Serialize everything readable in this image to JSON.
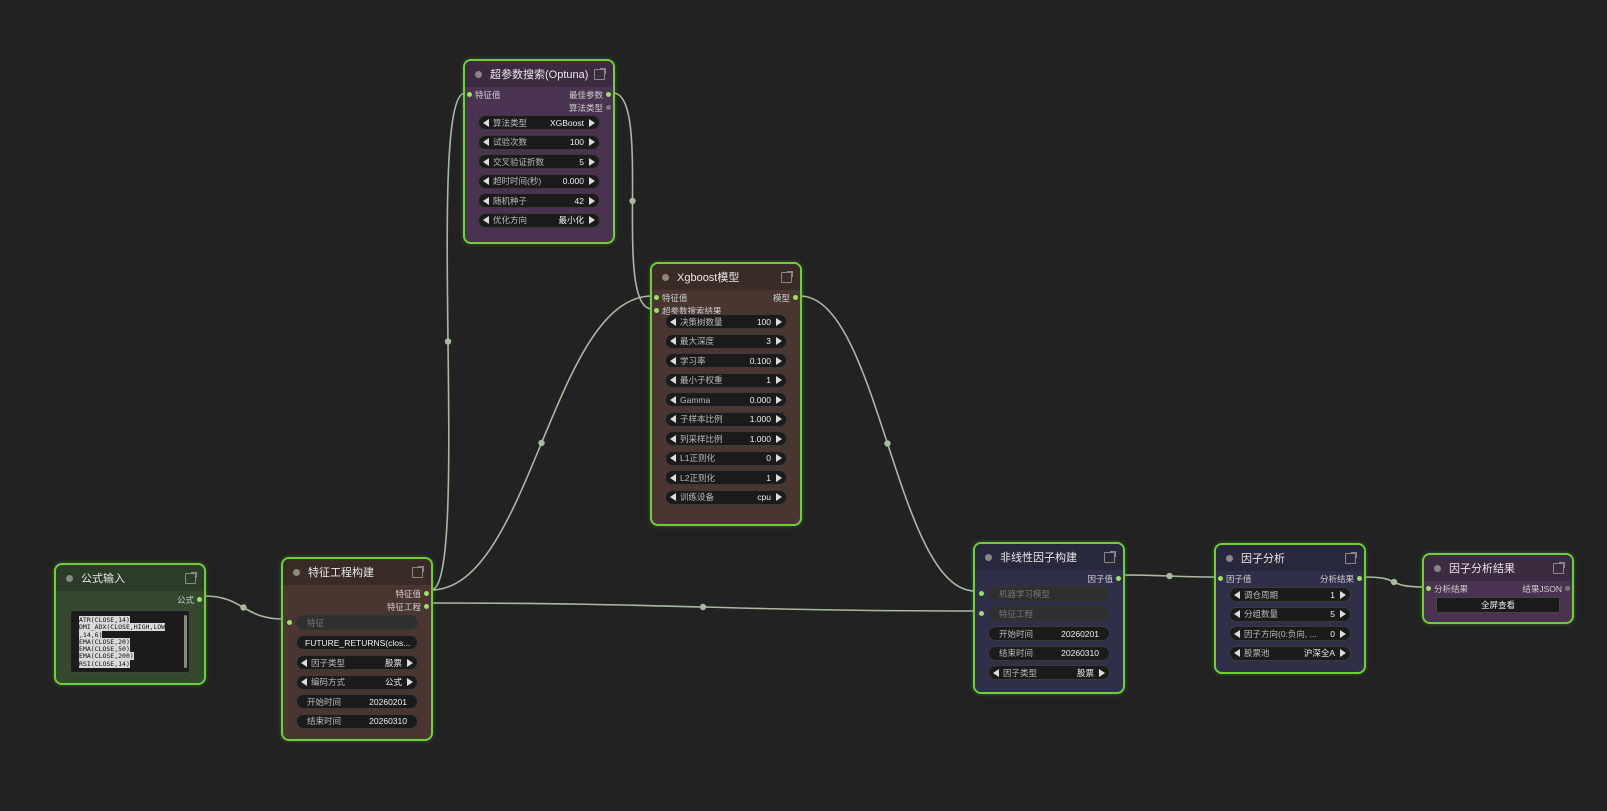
{
  "nodes": {
    "formula": {
      "title": "公式输入",
      "output": "公式",
      "lines": [
        "ATR(CLOSE,14)",
        "DMI_ADX(CLOSE,HIGH,LOW",
        ",14,6)",
        "EMA(CLOSE,20)",
        "EMA(CLOSE,50)",
        "EMA(CLOSE,200)",
        "RSI(CLOSE,14)"
      ],
      "colors": {
        "body": "#33482d",
        "head": "#2c3c28"
      }
    },
    "feature": {
      "title": "特征工程构建",
      "input": "特征",
      "outputs": [
        "特征值",
        "特征工程"
      ],
      "widget_input_label": "特征",
      "formula_value": "FUTURE_RETURNS(clos...",
      "widgets": [
        {
          "label": "因子类型",
          "value": "股票"
        },
        {
          "label": "编码方式",
          "value": "公式"
        },
        {
          "label": "开始时间",
          "value": "20260201"
        },
        {
          "label": "结束时间",
          "value": "20260310"
        }
      ],
      "colors": {
        "body": "#4a3630",
        "head": "#3b2b27"
      }
    },
    "optuna": {
      "title": "超参数搜索(Optuna)",
      "input": "特征值",
      "outputs": [
        "最佳参数",
        "算法类型"
      ],
      "widgets": [
        {
          "label": "算法类型",
          "value": "XGBoost"
        },
        {
          "label": "试验次数",
          "value": "100"
        },
        {
          "label": "交叉验证折数",
          "value": "5"
        },
        {
          "label": "超时时间(秒)",
          "value": "0.000"
        },
        {
          "label": "随机种子",
          "value": "42"
        },
        {
          "label": "优化方向",
          "value": "最小化"
        }
      ],
      "colors": {
        "body": "#4a3350",
        "head": "#3c2a40"
      }
    },
    "xgb": {
      "title": "Xgboost模型",
      "inputs": [
        "特征值",
        "超参数搜索结果"
      ],
      "output": "模型",
      "widgets": [
        {
          "label": "决策树数量",
          "value": "100"
        },
        {
          "label": "最大深度",
          "value": "3"
        },
        {
          "label": "学习率",
          "value": "0.100"
        },
        {
          "label": "最小子权重",
          "value": "1"
        },
        {
          "label": "Gamma",
          "value": "0.000"
        },
        {
          "label": "子样本比例",
          "value": "1.000"
        },
        {
          "label": "列采样比例",
          "value": "1.000"
        },
        {
          "label": "L1正则化",
          "value": "0"
        },
        {
          "label": "L2正则化",
          "value": "1"
        },
        {
          "label": "训练设备",
          "value": "cpu"
        }
      ],
      "colors": {
        "body": "#4a3630",
        "head": "#3b2b27"
      }
    },
    "nonlinear": {
      "title": "非线性因子构建",
      "output": "因子值",
      "disabled_inputs": [
        "机器学习模型",
        "特征工程"
      ],
      "widgets": [
        {
          "label": "开始时间",
          "value": "20260201"
        },
        {
          "label": "结束时间",
          "value": "20260310"
        },
        {
          "label": "因子类型",
          "value": "股票"
        }
      ],
      "colors": {
        "body": "#2f2f4a",
        "head": "#28283c"
      }
    },
    "analysis": {
      "title": "因子分析",
      "input": "因子值",
      "output": "分析结果",
      "widgets": [
        {
          "label": "调仓周期",
          "value": "1"
        },
        {
          "label": "分组数量",
          "value": "5"
        },
        {
          "label": "因子方向(0:负向,  ...",
          "value": "0"
        },
        {
          "label": "股票池",
          "value": "沪深全A"
        }
      ],
      "colors": {
        "body": "#2f2f4a",
        "head": "#28283c"
      }
    },
    "result": {
      "title": "因子分析结果",
      "input": "分析结果",
      "output": "结果JSON",
      "button": "全屏查看",
      "colors": {
        "body": "#4a3350",
        "head": "#3c2a40"
      }
    }
  },
  "link_color": "#a9b8a3",
  "canvas_bg": "#222222"
}
